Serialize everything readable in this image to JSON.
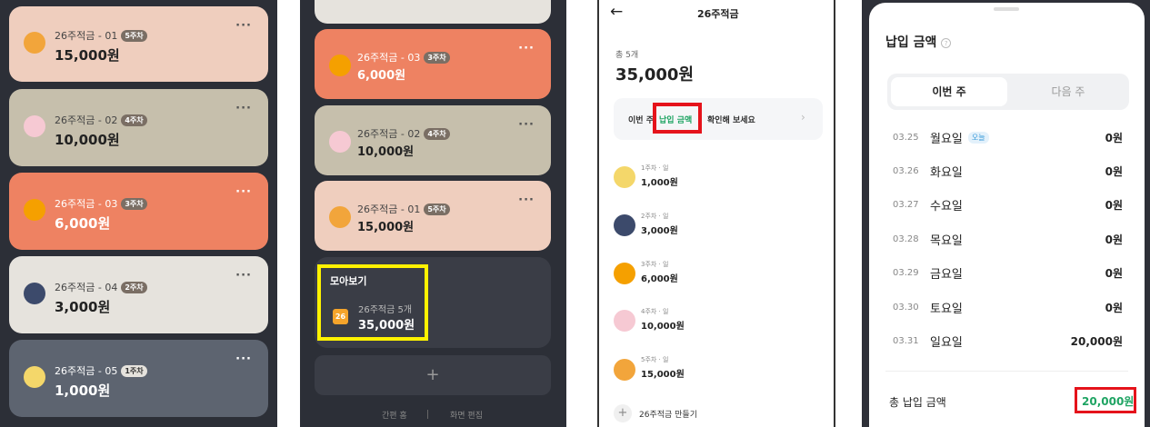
{
  "panel1": {
    "more": "···",
    "cards": [
      {
        "name": "26주적금 - 01",
        "badge": "5주차",
        "amount": "15,000원",
        "avatar": "ryan-icon"
      },
      {
        "name": "26주적금 - 02",
        "badge": "4주차",
        "amount": "10,000원",
        "avatar": "apeach-icon"
      },
      {
        "name": "26주적금 - 03",
        "badge": "3주차",
        "amount": "6,000원",
        "avatar": "neo-icon"
      },
      {
        "name": "26주적금 - 04",
        "badge": "2주차",
        "amount": "3,000원",
        "avatar": "jayg-icon"
      },
      {
        "name": "26주적금 - 05",
        "badge": "1주차",
        "amount": "1,000원",
        "avatar": "muzi-icon"
      }
    ]
  },
  "panel2": {
    "cards": [
      {
        "name": "26주적금 - 03",
        "badge": "3주차",
        "amount": "6,000원"
      },
      {
        "name": "26주적금 - 02",
        "badge": "4주차",
        "amount": "10,000원"
      },
      {
        "name": "26주적금 - 01",
        "badge": "5주차",
        "amount": "15,000원"
      }
    ],
    "summary": {
      "title": "모아보기",
      "icon_text": "26",
      "sub": "26주적금 5개",
      "amount": "35,000원"
    },
    "add": "+",
    "footer": {
      "home": "간편 홈",
      "edit": "화면 편집"
    }
  },
  "panel3": {
    "title": "26주적금",
    "total_label": "총 5개",
    "total_amount": "35,000원",
    "notice": {
      "prefix": "이번 주",
      "highlight": "납입 금액",
      "suffix": "확인해 보세요"
    },
    "items": [
      {
        "week": "1주차 · 일",
        "amount": "1,000원"
      },
      {
        "week": "2주차 · 일",
        "amount": "3,000원"
      },
      {
        "week": "3주차 · 일",
        "amount": "6,000원"
      },
      {
        "week": "4주차 · 일",
        "amount": "10,000원"
      },
      {
        "week": "5주차 · 일",
        "amount": "15,000원"
      }
    ],
    "create": "26주적금 만들기"
  },
  "panel4": {
    "title": "납입 금액",
    "tabs": {
      "this_week": "이번 주",
      "next_week": "다음 주"
    },
    "today_tag": "오늘",
    "rows": [
      {
        "date": "03.25",
        "day": "월요일",
        "amount": "0원"
      },
      {
        "date": "03.26",
        "day": "화요일",
        "amount": "0원"
      },
      {
        "date": "03.27",
        "day": "수요일",
        "amount": "0원"
      },
      {
        "date": "03.28",
        "day": "목요일",
        "amount": "0원"
      },
      {
        "date": "03.29",
        "day": "금요일",
        "amount": "0원"
      },
      {
        "date": "03.30",
        "day": "토요일",
        "amount": "0원"
      },
      {
        "date": "03.31",
        "day": "일요일",
        "amount": "20,000원"
      }
    ],
    "total_label": "총 납입 금액",
    "total_amount": "20,000원"
  },
  "colors": {
    "highlight_red": "#e5131b",
    "highlight_yellow": "#fff200",
    "accent_green": "#1fa463"
  }
}
